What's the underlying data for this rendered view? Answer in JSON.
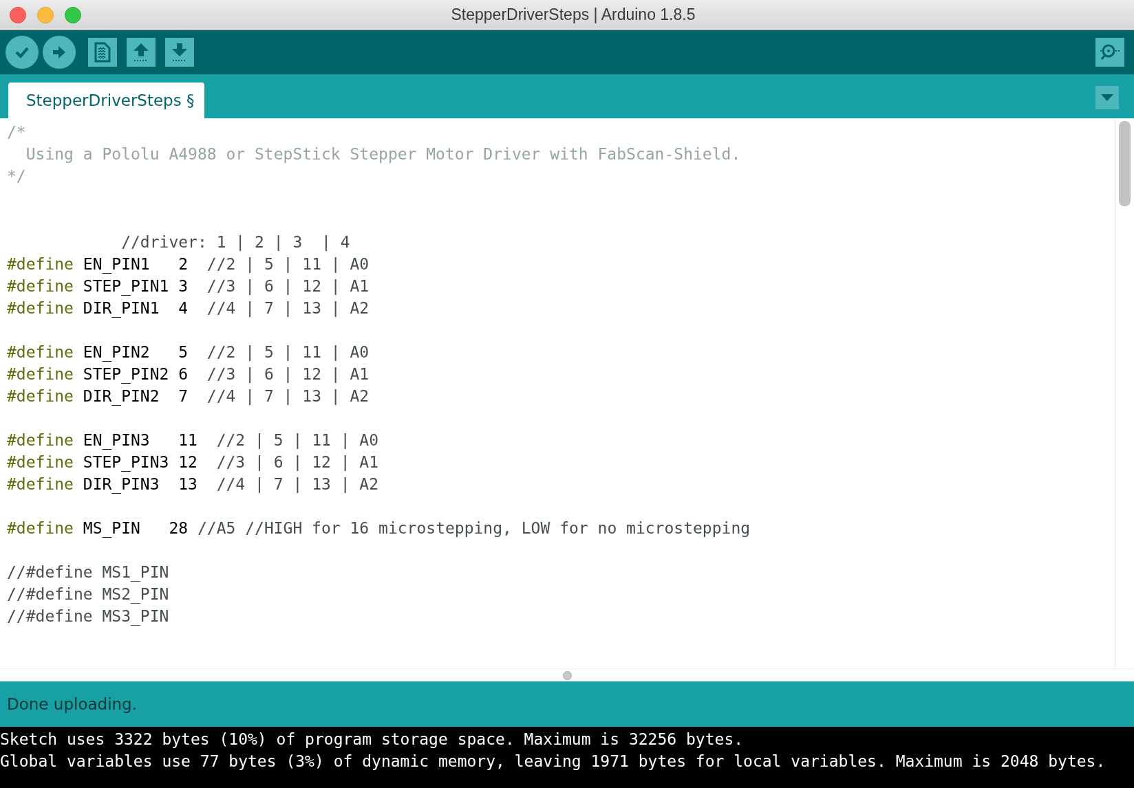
{
  "window": {
    "title": "StepperDriverSteps | Arduino 1.8.5"
  },
  "tabs": [
    {
      "label": "StepperDriverSteps §",
      "selected": true
    }
  ],
  "editor": {
    "lines": [
      {
        "kind": "code",
        "tokens": [
          {
            "kind": "doc_comment",
            "text": "/*"
          }
        ]
      },
      {
        "kind": "code",
        "tokens": [
          {
            "kind": "doc_comment",
            "text": "  Using a Pololu A4988 or StepStick Stepper Motor Driver with FabScan-Shield."
          }
        ]
      },
      {
        "kind": "code",
        "tokens": [
          {
            "kind": "doc_comment",
            "text": "*/"
          }
        ]
      },
      {
        "kind": "blank"
      },
      {
        "kind": "blank"
      },
      {
        "kind": "code",
        "tokens": [
          {
            "kind": "comment",
            "text": "            //driver: 1 | 2 | 3  | 4"
          }
        ]
      },
      {
        "kind": "code",
        "tokens": [
          {
            "kind": "directive",
            "text": "#define"
          },
          {
            "kind": "plain",
            "text": " EN_PIN1   2  "
          },
          {
            "kind": "comment",
            "text": "//2 | 5 | 11 | A0"
          }
        ]
      },
      {
        "kind": "code",
        "tokens": [
          {
            "kind": "directive",
            "text": "#define"
          },
          {
            "kind": "plain",
            "text": " STEP_PIN1 3  "
          },
          {
            "kind": "comment",
            "text": "//3 | 6 | 12 | A1"
          }
        ]
      },
      {
        "kind": "code",
        "tokens": [
          {
            "kind": "directive",
            "text": "#define"
          },
          {
            "kind": "plain",
            "text": " DIR_PIN1  4  "
          },
          {
            "kind": "comment",
            "text": "//4 | 7 | 13 | A2"
          }
        ]
      },
      {
        "kind": "blank"
      },
      {
        "kind": "code",
        "tokens": [
          {
            "kind": "directive",
            "text": "#define"
          },
          {
            "kind": "plain",
            "text": " EN_PIN2   5  "
          },
          {
            "kind": "comment",
            "text": "//2 | 5 | 11 | A0"
          }
        ]
      },
      {
        "kind": "code",
        "tokens": [
          {
            "kind": "directive",
            "text": "#define"
          },
          {
            "kind": "plain",
            "text": " STEP_PIN2 6  "
          },
          {
            "kind": "comment",
            "text": "//3 | 6 | 12 | A1"
          }
        ]
      },
      {
        "kind": "code",
        "tokens": [
          {
            "kind": "directive",
            "text": "#define"
          },
          {
            "kind": "plain",
            "text": " DIR_PIN2  7  "
          },
          {
            "kind": "comment",
            "text": "//4 | 7 | 13 | A2"
          }
        ]
      },
      {
        "kind": "blank"
      },
      {
        "kind": "code",
        "tokens": [
          {
            "kind": "directive",
            "text": "#define"
          },
          {
            "kind": "plain",
            "text": " EN_PIN3   11  "
          },
          {
            "kind": "comment",
            "text": "//2 | 5 | 11 | A0"
          }
        ]
      },
      {
        "kind": "code",
        "tokens": [
          {
            "kind": "directive",
            "text": "#define"
          },
          {
            "kind": "plain",
            "text": " STEP_PIN3 12  "
          },
          {
            "kind": "comment",
            "text": "//3 | 6 | 12 | A1"
          }
        ]
      },
      {
        "kind": "code",
        "tokens": [
          {
            "kind": "directive",
            "text": "#define"
          },
          {
            "kind": "plain",
            "text": " DIR_PIN3  13  "
          },
          {
            "kind": "comment",
            "text": "//4 | 7 | 13 | A2"
          }
        ]
      },
      {
        "kind": "blank"
      },
      {
        "kind": "code",
        "tokens": [
          {
            "kind": "directive",
            "text": "#define"
          },
          {
            "kind": "plain",
            "text": " MS_PIN   28 "
          },
          {
            "kind": "comment",
            "text": "//A5 //HIGH for 16 microstepping, LOW for no microstepping"
          }
        ]
      },
      {
        "kind": "blank"
      },
      {
        "kind": "code",
        "tokens": [
          {
            "kind": "comment",
            "text": "//#define MS1_PIN"
          }
        ]
      },
      {
        "kind": "code",
        "tokens": [
          {
            "kind": "comment",
            "text": "//#define MS2_PIN"
          }
        ]
      },
      {
        "kind": "code",
        "tokens": [
          {
            "kind": "comment",
            "text": "//#define MS3_PIN"
          }
        ]
      }
    ]
  },
  "status": {
    "message": "Done uploading."
  },
  "console": {
    "lines": [
      "Sketch uses 3322 bytes (10%) of program storage space. Maximum is 32256 bytes.",
      "Global variables use 77 bytes (3%) of dynamic memory, leaving 1971 bytes for local variables. Maximum is 2048 bytes."
    ]
  }
}
